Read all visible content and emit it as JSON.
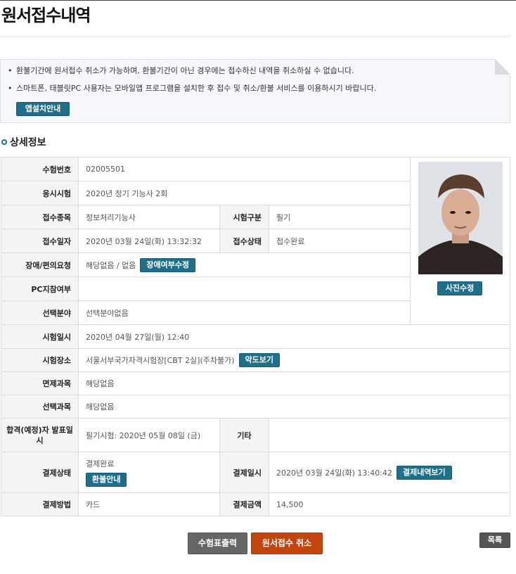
{
  "page": {
    "title": "원서접수내역"
  },
  "notice": {
    "items": [
      "환불기간에 원서접수 취소가 가능하며, 환불기간이 아닌 경우에는 접수하신 내역을 취소하실 수 없습니다.",
      "스마트폰, 태블릿PC 사용자는 모바일앱 프로그램을 설치한 후 접수 및 취소/환불 서비스를 이용하시기 바랍니다."
    ],
    "app_button": "앱설치안내"
  },
  "section": {
    "title": "상세정보"
  },
  "detail": {
    "exam_number": {
      "label": "수험번호",
      "value": "02005501"
    },
    "exam_name": {
      "label": "응시시험",
      "value": "2020년 정기 기능사 2회"
    },
    "category": {
      "label": "접수종목",
      "value": "정보처리기능사"
    },
    "exam_type": {
      "label": "시험구분",
      "value": "필기"
    },
    "apply_date": {
      "label": "접수일자",
      "value": "2020년 03월 24일(화) 13:32:32"
    },
    "apply_status": {
      "label": "접수상태",
      "value": "접수완료"
    },
    "disability": {
      "label": "장애/편의요청",
      "value": "해당없음 / 없음",
      "button": "장애여부수정"
    },
    "pc_ref": {
      "label": "PC지참여부",
      "value": ""
    },
    "field": {
      "label": "선택분야",
      "value": "선택분야없음"
    },
    "exam_datetime": {
      "label": "시험일시",
      "value": "2020년 04월 27일(월) 12:40"
    },
    "exam_place": {
      "label": "시험장소",
      "value": "서울서부국가자격시험장[CBT 2실](주차불가)",
      "button": "약도보기"
    },
    "exempt_subject": {
      "label": "면제과목",
      "value": "해당없음"
    },
    "select_subject": {
      "label": "선택과목",
      "value": "해당없음"
    },
    "result_date": {
      "label": "합격(예정)자 발표일시",
      "value": "필기시험: 2020년 05월 08일 (금)"
    },
    "etc": {
      "label": "기타",
      "value": ""
    },
    "pay_status": {
      "label": "결제상태",
      "value": "결제완료",
      "button": "환불안내"
    },
    "pay_date": {
      "label": "결제일시",
      "value": "2020년 03월 24일(화) 13:40:42",
      "button": "결제내역보기"
    },
    "pay_method": {
      "label": "결제방법",
      "value": "카드"
    },
    "pay_amount": {
      "label": "결제금액",
      "value": "14,500"
    },
    "photo_button": "사진수정"
  },
  "actions": {
    "print": "수험표출력",
    "cancel": "원서접수 취소",
    "list": "목록"
  },
  "colors": {
    "button_blue": "#1f6f8b",
    "cancel_red": "#c2450f",
    "gray_button": "#666666"
  }
}
